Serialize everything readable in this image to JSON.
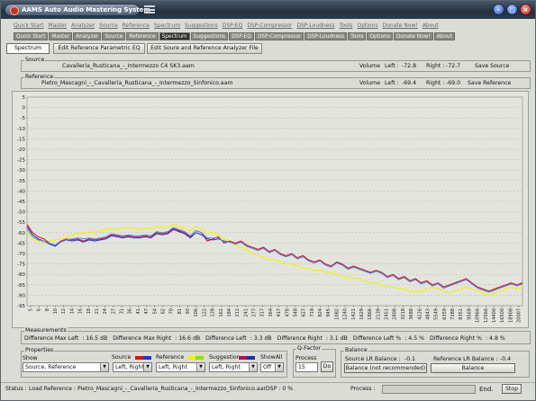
{
  "window": {
    "title": "AAMS Auto Audio Mastering System",
    "min_glyph": "–",
    "max_glyph": "□",
    "close_glyph": "×"
  },
  "menu": [
    "Quick Start",
    "Master",
    "Analyzer",
    "Source",
    "Reference",
    "Spectrum",
    "Suggestions",
    "DSP-EQ",
    "DSP-Compressor",
    "DSP-Loudness",
    "Tools",
    "Options",
    "Donate Now!",
    "About"
  ],
  "tabs": [
    "Quick Start",
    "Master",
    "Analyzer",
    "Source",
    "Reference",
    "Spectrum",
    "Suggestions",
    "DSP-EQ",
    "DSP-Compressor",
    "DSP-Loudness",
    "Tools",
    "Options",
    "Donate Now!",
    "About"
  ],
  "active_tab": "Spectrum",
  "subtabs": [
    "Spectrum",
    "Edit Reference Parametric EQ",
    "Edit Soure and Reference Analyzer File"
  ],
  "source": {
    "group_label": "Source",
    "file": "Cavalleria_Rusticana_-_Intermezzo C4 SK3.aam",
    "volume_label": "Volume",
    "left_label": "Left :",
    "left_value": "-72.8",
    "right_label": "Right :",
    "right_value": "-72.7",
    "save_label": "Save Source"
  },
  "reference": {
    "group_label": "Reference",
    "file": "Pietro_Mascagni_-_Cavalleria_Rusticana_-_Intermezzo_Sinfonico.aam",
    "volume_label": "Volume",
    "left_label": "Left :",
    "left_value": "-69.4",
    "right_label": "Right :",
    "right_value": "-69.0",
    "save_label": "Save Reference"
  },
  "chart_data": {
    "type": "line",
    "ylim": [
      -95,
      5
    ],
    "yticks": [
      "5",
      "0",
      "-5",
      "-10",
      "-15",
      "-20",
      "-25",
      "-30",
      "-35",
      "-40",
      "-45",
      "-50",
      "-55",
      "-60",
      "-65",
      "-70",
      "-75",
      "-80",
      "-85",
      "-90",
      "-95"
    ],
    "xticks": [
      "5",
      "6",
      "8",
      "10",
      "12",
      "14",
      "16",
      "18",
      "21",
      "24",
      "27",
      "31",
      "36",
      "41",
      "47",
      "54",
      "62",
      "70",
      "81",
      "93",
      "106",
      "122",
      "139",
      "161",
      "184",
      "211",
      "241",
      "277",
      "317",
      "364",
      "417",
      "478",
      "548",
      "627",
      "719",
      "824",
      "945",
      "1082",
      "1240",
      "1421",
      "1629",
      "1866",
      "2139",
      "2451",
      "2808",
      "3218",
      "3688",
      "4226",
      "4843",
      "5549",
      "6359",
      "7288",
      "8351",
      "9569",
      "10966",
      "12566",
      "14400",
      "16500",
      "18908",
      "20007"
    ],
    "series": [
      {
        "key": "source_left",
        "color": "#e01010",
        "values": [
          -56,
          -60,
          -62,
          -63,
          -65,
          -66,
          -64,
          -63,
          -63.5,
          -63,
          -64,
          -63,
          -63.5,
          -63,
          -62.5,
          -61,
          -61.5,
          -62,
          -61.5,
          -62,
          -62,
          -61.5,
          -62,
          -60,
          -60.5,
          -60,
          -58,
          -59,
          -60,
          -62,
          -59,
          -60,
          -64,
          -63,
          -62,
          -65,
          -64,
          -65,
          -64,
          -66,
          -67,
          -68,
          -67,
          -69,
          -68,
          -70,
          -71,
          -70,
          -72,
          -71,
          -73,
          -74,
          -73,
          -75,
          -76,
          -74,
          -75,
          -77,
          -76,
          -77,
          -78,
          -79,
          -78,
          -79,
          -81,
          -80,
          -82,
          -81,
          -83,
          -82,
          -84,
          -83,
          -85,
          -84,
          -86,
          -85,
          -84,
          -83,
          -82,
          -84,
          -86,
          -87,
          -88,
          -87,
          -86,
          -85,
          -84,
          -85,
          -84
        ]
      },
      {
        "key": "source_right",
        "color": "#1a3acc",
        "values": [
          -57,
          -61,
          -63,
          -64,
          -65.5,
          -66.5,
          -64.5,
          -63.5,
          -64,
          -63.5,
          -64.5,
          -63.5,
          -64,
          -63.5,
          -63,
          -61.5,
          -62,
          -62.5,
          -62,
          -62.5,
          -62.5,
          -62,
          -62.5,
          -60.5,
          -61,
          -60.5,
          -58.5,
          -59.5,
          -60.5,
          -62.5,
          -60,
          -61,
          -63,
          -63.5,
          -63,
          -64,
          -64.5,
          -65.5,
          -64.5,
          -66.5,
          -67.5,
          -68.5,
          -67.5,
          -69.5,
          -68.5,
          -70.5,
          -71.5,
          -70.5,
          -72.5,
          -71.5,
          -73.5,
          -74.5,
          -73.5,
          -75.5,
          -76.5,
          -74.5,
          -75.5,
          -77.5,
          -76.5,
          -77.5,
          -78.5,
          -79.5,
          -78.5,
          -79.5,
          -81.5,
          -80.5,
          -82.5,
          -81.5,
          -83.5,
          -82.5,
          -84.5,
          -83.5,
          -85.5,
          -84.5,
          -86.5,
          -85.5,
          -84.5,
          -83.5,
          -82.5,
          -84.5,
          -86.5,
          -87.5,
          -88.5,
          -87.5,
          -86.5,
          -85.5,
          -84.5,
          -85.5,
          -84.5
        ]
      },
      {
        "key": "reference",
        "color": "#f0f020",
        "values": [
          -60,
          -63,
          -64,
          -64.5,
          -64,
          -63.5,
          -63,
          -62,
          -61,
          -60.5,
          -60,
          -59.5,
          -60,
          -59,
          -58.5,
          -58,
          -58.5,
          -58,
          -57.5,
          -58,
          -58.5,
          -58,
          -58,
          -57,
          -57.5,
          -57,
          -56,
          -57,
          -58,
          -59,
          -57,
          -58,
          -60,
          -60,
          -61,
          -63,
          -64,
          -66,
          -67,
          -68,
          -70,
          -71,
          -72,
          -73,
          -73,
          -74,
          -75,
          -75,
          -76,
          -77,
          -77,
          -78,
          -78,
          -79,
          -79,
          -80,
          -81,
          -81,
          -82,
          -82,
          -83,
          -84,
          -84,
          -85,
          -86,
          -86,
          -87,
          -87,
          -88,
          -88,
          -88,
          -87,
          -86,
          -87,
          -88,
          -89,
          -88,
          -87,
          -86,
          -87,
          -88,
          -89,
          -90,
          -89,
          -88,
          -87,
          -86,
          -87,
          -86
        ]
      },
      {
        "key": "suggestion",
        "color": "#5a8ad8",
        "values": [
          -58,
          -62,
          -63.5,
          -64,
          -65,
          -66,
          -64.5,
          -63.5,
          -63,
          -62.5,
          -63,
          -62.5,
          -63,
          -62.5,
          -62,
          -60.5,
          -61,
          -61.5,
          -61,
          -61.5,
          -61.5,
          -61,
          -61.5,
          -59.5,
          -60,
          -59.5,
          -57.5,
          -58.5,
          -59.5,
          -61.5,
          -59,
          -60,
          -62.5,
          -62.5,
          -62.5,
          -64.5,
          -64.5,
          -65.5,
          -64.5,
          -66.5,
          -67.5,
          -68.5,
          -67.5,
          -69.5,
          -68.5,
          -70.5,
          -71.5,
          -70.5,
          -72.5,
          -71.5,
          -73.5,
          -74.5,
          -73.5,
          -75.5,
          -76.5,
          -74.5,
          -75.5,
          -77.5,
          -76.5,
          -77.5,
          -78.5,
          -79.5,
          -78.5,
          -79.5,
          -81.5,
          -80.5,
          -82.5,
          -81.5,
          -83.5,
          -82.5,
          -84.5,
          -83.5,
          -85.5,
          -84.5,
          -86.5,
          -85.5,
          -84.5,
          -83.5,
          -82.5,
          -84.5,
          -86.5,
          -87.5,
          -88.5,
          -87.5,
          -86.5,
          -85.5,
          -84.5,
          -85.5,
          -84.5
        ]
      }
    ],
    "grid": true
  },
  "measurements": {
    "group_label": "Measurements",
    "items": [
      {
        "label": "Difference Max Left",
        "value": ": 16.5 dB"
      },
      {
        "label": "Difference Max Right",
        "value": ": 16.6 dB"
      },
      {
        "label": "Difference Left",
        "value": ": 3.3 dB"
      },
      {
        "label": "Difference Right",
        "value": ": 3.1 dB"
      },
      {
        "label": "Difference Left %",
        "value": ": 4.5 %"
      },
      {
        "label": "Difference Right %",
        "value": ": 4.8 %"
      }
    ]
  },
  "properties": {
    "group_label": "Properties",
    "show_label": "Show",
    "show_value": "Source, Reference",
    "source_label": "Source",
    "source_value": "Left, Right",
    "reference_label": "Reference",
    "reference_value": "Left, Right",
    "suggestion_label": "Suggestion",
    "suggestion_value": "Left, Right",
    "showall_label": "ShowAll",
    "showall_value": "Off",
    "colors": {
      "source_left": "#e01010",
      "source_right": "#1a3acc",
      "reference_left": "#f0f020",
      "reference_right": "#8adc20",
      "suggestion_left": "#b01060",
      "suggestion_right": "#2030a0"
    }
  },
  "qfactor": {
    "group_label": "Q-Factor",
    "process_label": "Process",
    "value": "15",
    "do_label": "Do"
  },
  "balance": {
    "group_label": "Balance",
    "source_label": "Source LR Balance :",
    "source_value": "-0.1",
    "reference_label": "Reference LR Balance :",
    "reference_value": "-0.4",
    "source_btn": "Balance (not recommended)",
    "reference_btn": "Balance"
  },
  "status": {
    "label": "Status :",
    "message": "Load Reference : Pietro_Mascagni_-_Cavalleria_Rusticana_-_Intermezzo_Sinfonico.aarDSP : 0 %",
    "process_label": "Process :",
    "progress": 0,
    "end_label": "End.",
    "stop_label": "Stop"
  }
}
